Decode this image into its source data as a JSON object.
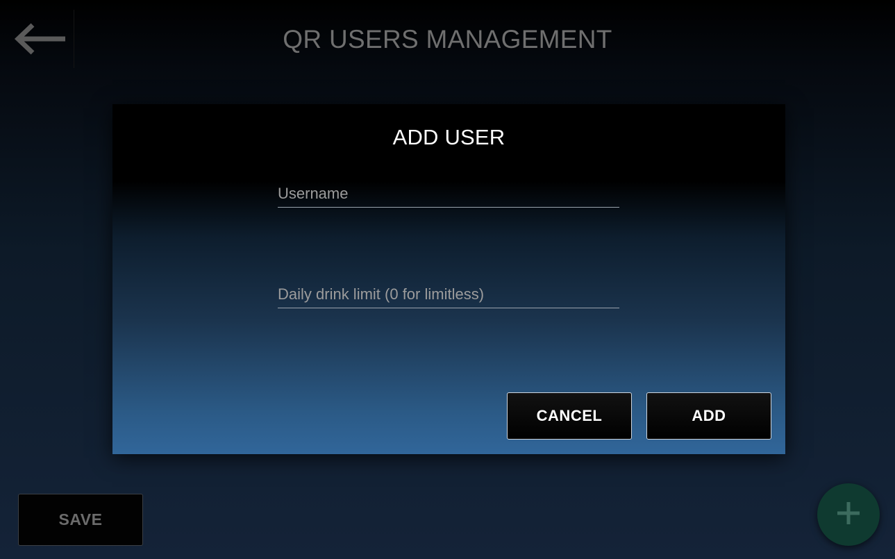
{
  "header": {
    "title": "QR USERS MANAGEMENT",
    "back_icon": "arrow-left-icon"
  },
  "dialog": {
    "title": "ADD USER",
    "username_placeholder": "Username",
    "username_value": "",
    "limit_placeholder": "Daily drink limit (0 for limitless)",
    "limit_value": "",
    "cancel_label": "CANCEL",
    "add_label": "ADD"
  },
  "footer": {
    "save_label": "SAVE",
    "fab_icon": "plus-icon"
  },
  "colors": {
    "fab_background": "#0f3a30",
    "fab_icon": "#3c6b5e",
    "title_color": "#6f6f6f",
    "dialog_bottom": "#31669a"
  }
}
